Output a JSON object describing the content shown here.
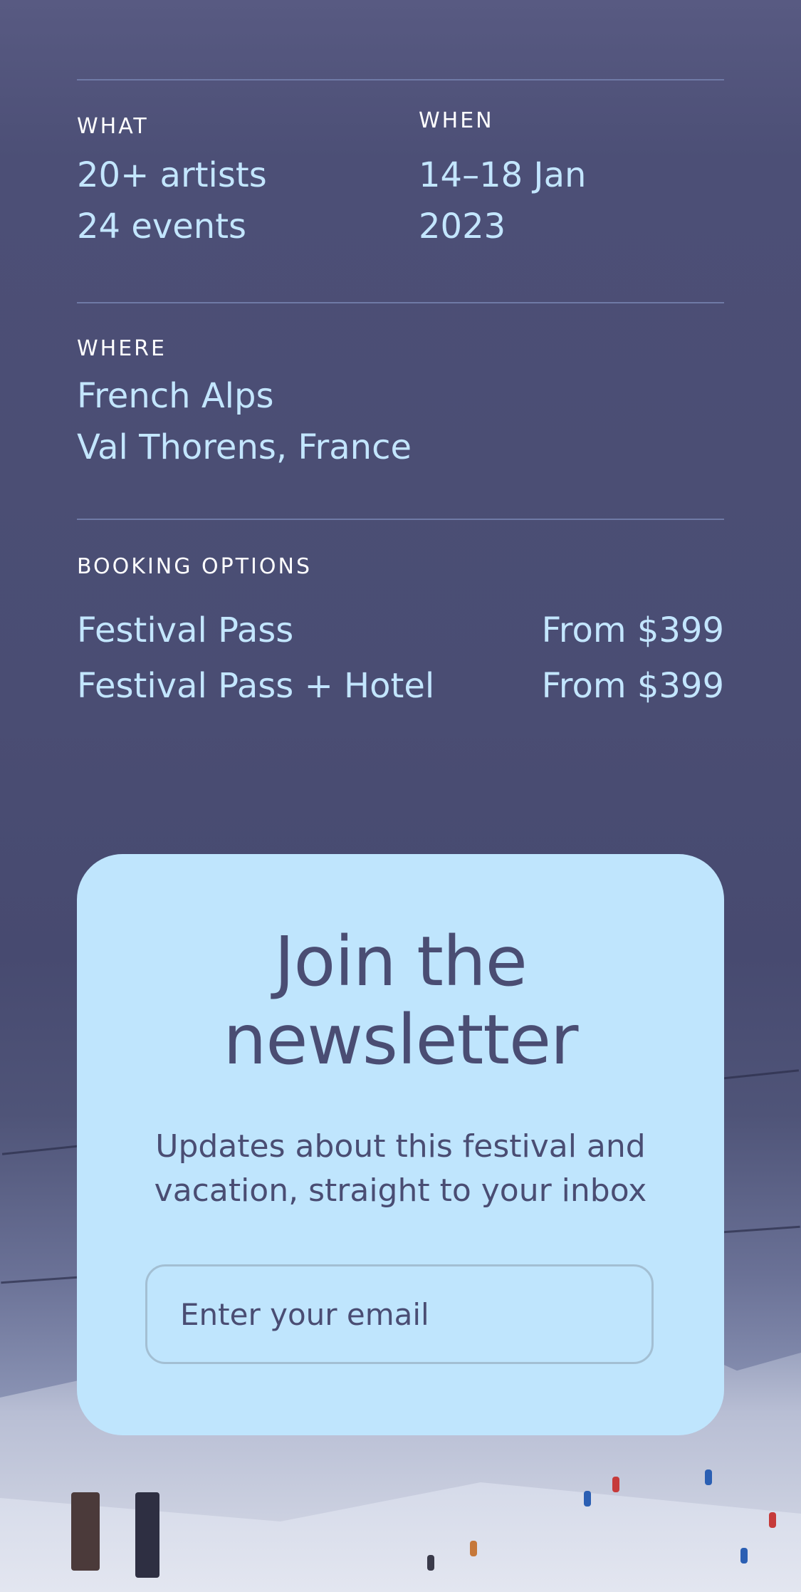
{
  "details": {
    "what": {
      "label": "WHAT",
      "line1": "20+ artists",
      "line2": "24 events"
    },
    "when": {
      "label": "WHEN",
      "line1": "14–18 Jan",
      "line2": "2023"
    },
    "where": {
      "label": "WHERE",
      "line1": "French Alps",
      "line2": "Val Thorens, France"
    }
  },
  "booking": {
    "label": "BOOKING OPTIONS",
    "options": [
      {
        "name": "Festival Pass",
        "price": "From $399"
      },
      {
        "name": "Festival Pass + Hotel",
        "price": "From $399"
      }
    ]
  },
  "newsletter": {
    "title_line1": "Join the",
    "title_line2": "newsletter",
    "subtitle_line1": "Updates about this festival and",
    "subtitle_line2": "vacation, straight to your inbox",
    "email_placeholder": "Enter your email"
  },
  "colors": {
    "background": "#4a4d73",
    "accent_text": "#c3e6ff",
    "card": "#bfe5fd",
    "card_text": "#4a4d73"
  }
}
